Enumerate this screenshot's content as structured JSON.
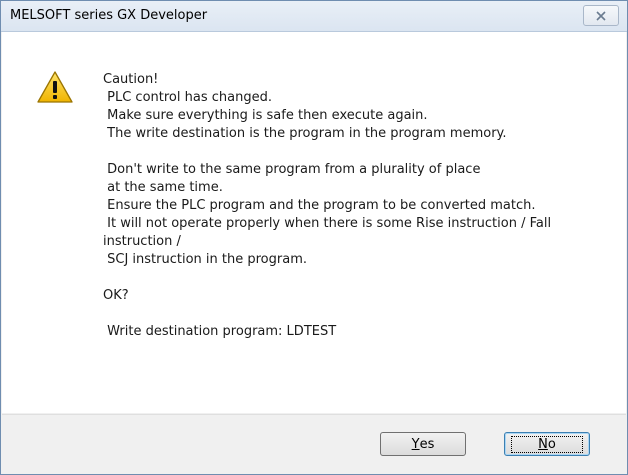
{
  "window": {
    "title": "MELSOFT series GX Developer",
    "close_icon": "close-x-icon"
  },
  "dialog": {
    "icon": "warning-triangle-icon",
    "lines": [
      "Caution!",
      " PLC control has changed.",
      " Make sure everything is safe then execute again.",
      " The write destination is the program in the program memory.",
      "",
      " Don't write to the same program from a plurality of place",
      " at the same time.",
      " Ensure the PLC program and the program to be converted match.",
      " It will not operate properly when there is some Rise instruction / Fall",
      "instruction /",
      " SCJ instruction in the program.",
      "",
      "OK?",
      "",
      " Write destination program: LDTEST"
    ]
  },
  "buttons": {
    "yes_mnemonic": "Y",
    "yes_rest": "es",
    "no_mnemonic": "N",
    "no_rest": "o"
  },
  "colors": {
    "warning_fill": "#f5c400",
    "focus_border": "#3c7fb1"
  }
}
